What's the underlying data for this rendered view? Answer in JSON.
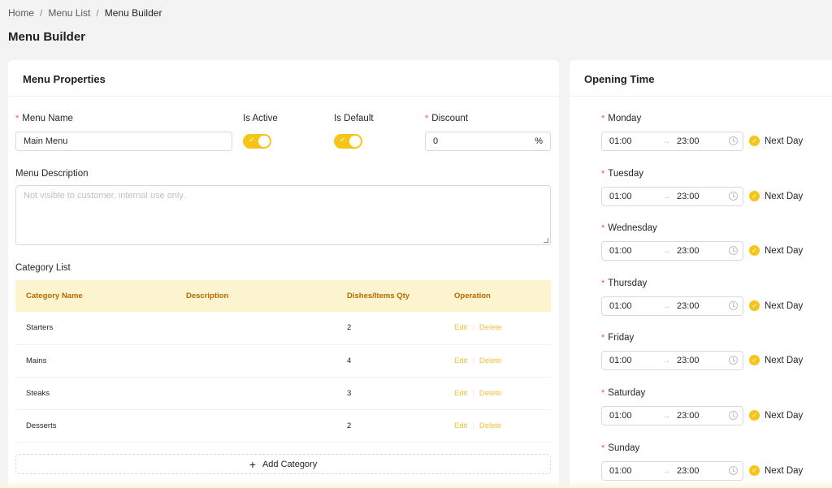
{
  "breadcrumb": {
    "home": "Home",
    "sep": "/",
    "list": "Menu List",
    "current": "Menu Builder"
  },
  "page_title": "Menu Builder",
  "menu_properties": {
    "title": "Menu Properties",
    "menu_name_label": "Menu Name",
    "menu_name_value": "Main Menu",
    "is_active_label": "Is Active",
    "is_active": true,
    "is_default_label": "Is Default",
    "is_default": true,
    "discount_label": "Discount",
    "discount_value": "0",
    "discount_suffix": "%",
    "description_label": "Menu Description",
    "description_placeholder": "Not visible to customer, internal use only.",
    "category_list_label": "Category List",
    "columns": [
      "Category Name",
      "Description",
      "Dishes/Items Qty",
      "Operation"
    ],
    "categories": [
      {
        "name": "Starters",
        "description": "",
        "qty": "2"
      },
      {
        "name": "Mains",
        "description": "",
        "qty": "4"
      },
      {
        "name": "Steaks",
        "description": "",
        "qty": "3"
      },
      {
        "name": "Desserts",
        "description": "",
        "qty": "2"
      }
    ],
    "edit_label": "Edit",
    "delete_label": "Delete",
    "add_category": "Add Category"
  },
  "opening_time": {
    "title": "Opening Time",
    "next_day_label": "Next Day",
    "days": [
      {
        "day": "Monday",
        "start": "01:00",
        "end": "23:00"
      },
      {
        "day": "Tuesday",
        "start": "01:00",
        "end": "23:00"
      },
      {
        "day": "Wednesday",
        "start": "01:00",
        "end": "23:00"
      },
      {
        "day": "Thursday",
        "start": "01:00",
        "end": "23:00"
      },
      {
        "day": "Friday",
        "start": "01:00",
        "end": "23:00"
      },
      {
        "day": "Saturday",
        "start": "01:00",
        "end": "23:00"
      },
      {
        "day": "Sunday",
        "start": "01:00",
        "end": "23:00"
      }
    ]
  },
  "colors": {
    "accent": "#f5c518",
    "table_header_bg": "#fcf3cf",
    "table_header_text": "#b36b00",
    "link": "#f0c040"
  }
}
